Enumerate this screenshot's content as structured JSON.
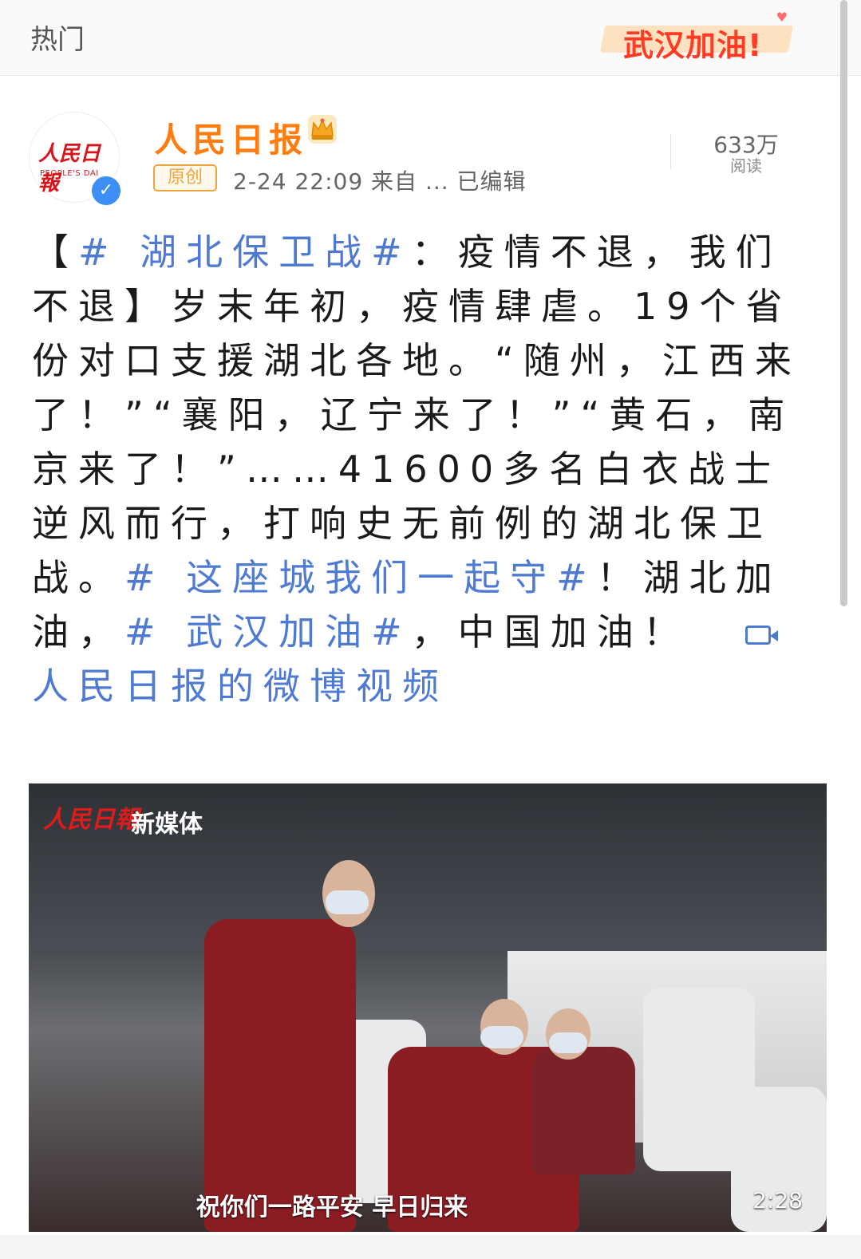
{
  "topbar": {
    "tab": "热门",
    "banner": "武汉加油!"
  },
  "post": {
    "author": "人民日报",
    "avatar_logo": "人民日報",
    "avatar_sub": "PEOPLE'S DAI",
    "original_tag": "原创",
    "meta": "2-24 22:09  来自  ...  已编辑",
    "read_count": "633万",
    "read_label": "阅读",
    "body": {
      "bracket_open": "【",
      "topic1": "# 湖北保卫战#",
      "seg1": "：疫情不退，我们不退】岁末年初，疫情肆虐。19个省份对口支援湖北各地。“随州，江西来了！”“襄阳，辽宁来了！”“黄石，南京来了！”……41600多名白衣战士逆风而行，打响史无前例的湖北保卫战。",
      "topic2": "# 这座城我们一起守#",
      "seg2": "！湖北加油，",
      "topic3": "# 武汉加油#",
      "seg3": "，中国加油！",
      "video_link": "人民日报的微博视频"
    }
  },
  "video": {
    "logo": "人民日報",
    "logo_sub": "新媒体",
    "subtitle": "祝你们一路平安 早日归来",
    "duration": "2:28"
  }
}
